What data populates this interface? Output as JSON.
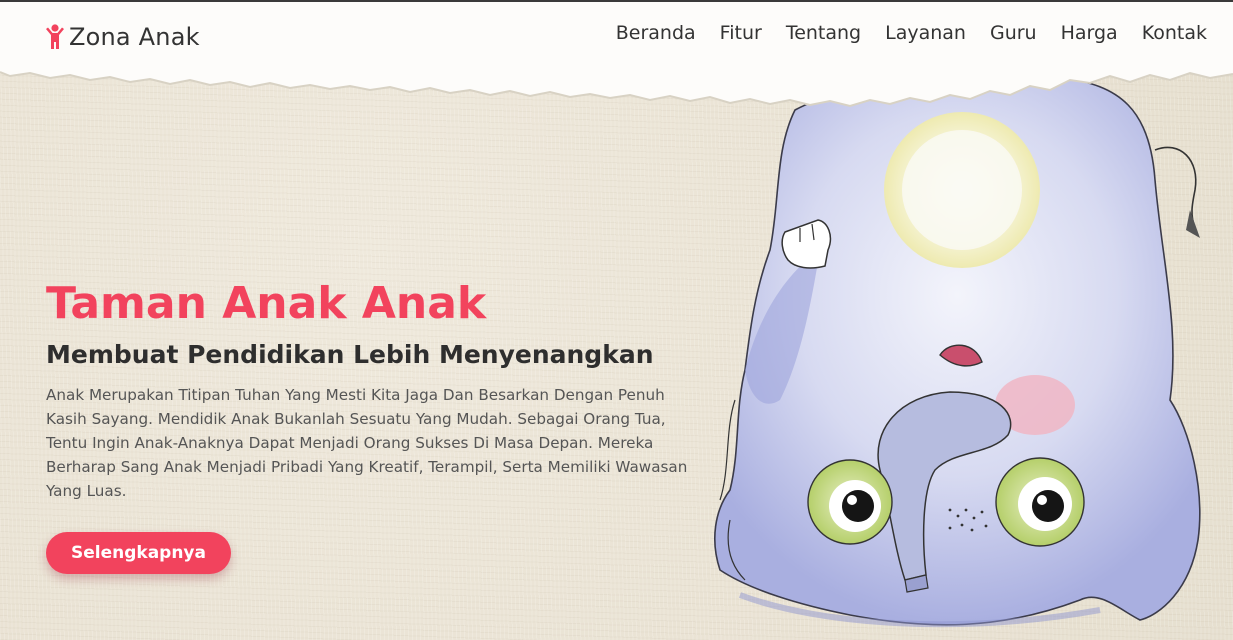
{
  "brand": {
    "name": "Zona Anak",
    "accent_color": "#f2435d",
    "icon": "child-figure-icon"
  },
  "nav": {
    "items": [
      {
        "label": "Beranda"
      },
      {
        "label": "Fitur"
      },
      {
        "label": "Tentang"
      },
      {
        "label": "Layanan"
      },
      {
        "label": "Guru"
      },
      {
        "label": "Harga"
      },
      {
        "label": "Kontak"
      }
    ]
  },
  "hero": {
    "title": "Taman Anak Anak",
    "subtitle": "Membuat Pendidikan Lebih Menyenangkan",
    "description": "Anak Merupakan Titipan Tuhan Yang Mesti Kita Jaga Dan Besarkan Dengan Penuh Kasih Sayang. Mendidik Anak Bukanlah Sesuatu Yang Mudah. Sebagai Orang Tua, Tentu Ingin Anak-Anaknya Dapat Menjadi Orang Sukses Di Masa Depan. Mereka Berharap Sang Anak Menjadi Pribadi Yang Kreatif, Terampil, Serta Memiliki Wawasan Yang Luas.",
    "cta_label": "Selengkapnya"
  },
  "illustration": {
    "subject": "watercolor-elephant-illustration"
  }
}
